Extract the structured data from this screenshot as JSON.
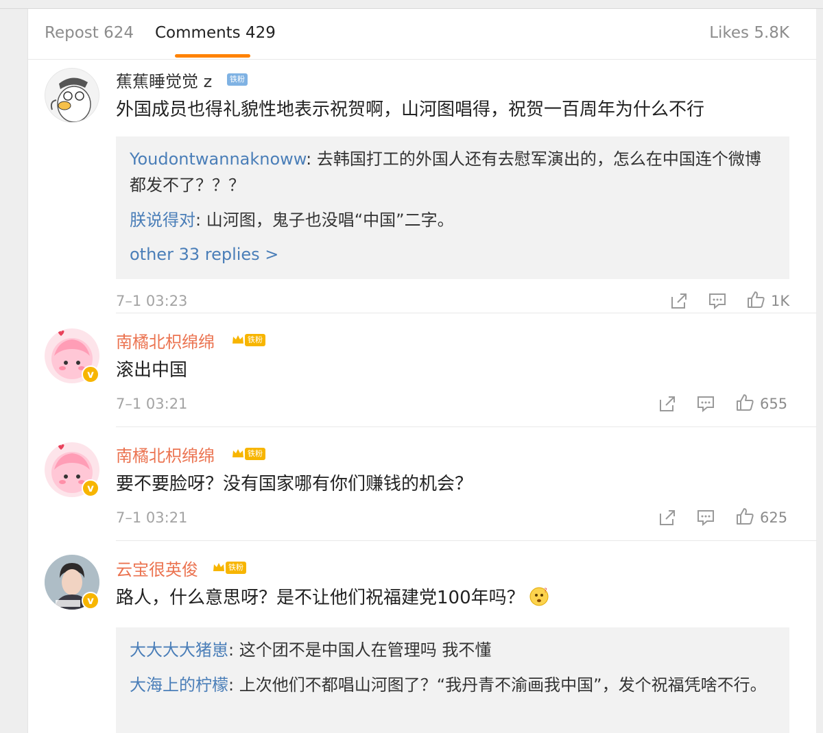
{
  "tabs": {
    "repost": "Repost 624",
    "comments": "Comments 429",
    "likes": "Likes 5.8K"
  },
  "accent_color": "#ff8200",
  "comments": [
    {
      "user": "蕉蕉睡觉觉 z",
      "badge": "铁粉",
      "text": "外国成员也得礼貌性地表示祝贺啊，山河图唱得，祝贺一百周年为什么不行",
      "replies": [
        {
          "user": "Youdontwannaknoww",
          "text": ": 去韩国打工的外国人还有去慰军演出的，怎么在中国连个微博都发不了？？？"
        },
        {
          "user": "朕说得对",
          "text": ": 山河图，鬼子也没唱“中国”二字。"
        }
      ],
      "more": "other 33 replies >",
      "time": "7–1 03:23",
      "likes": "1K"
    },
    {
      "user": "南橘北枳绵绵",
      "badge": "铁粉",
      "text": "滚出中国",
      "time": "7–1 03:21",
      "likes": "655"
    },
    {
      "user": "南橘北枳绵绵",
      "badge": "铁粉",
      "text": "要不要脸呀？没有国家哪有你们赚钱的机会？",
      "time": "7–1 03:21",
      "likes": "625"
    },
    {
      "user": "云宝很英俊",
      "badge": "铁粉",
      "text": "路人，什么意思呀？是不让他们祝福建党100年吗？",
      "replies": [
        {
          "user": "大大大大猪崽",
          "text": ": 这个团不是中国人在管理吗 我不懂"
        },
        {
          "user": "大海上的柠檬",
          "text": ": 上次他们不都唱山河图了？“我丹青不渝画我中国”，发个祝福凭啥不行。"
        }
      ]
    }
  ],
  "icons": {
    "share": "share-icon",
    "comment": "comment-icon",
    "like": "thumbs-up-icon",
    "verified": "verified-badge-icon",
    "crown": "crown-icon",
    "emoji": "thinking-emoji-icon"
  }
}
